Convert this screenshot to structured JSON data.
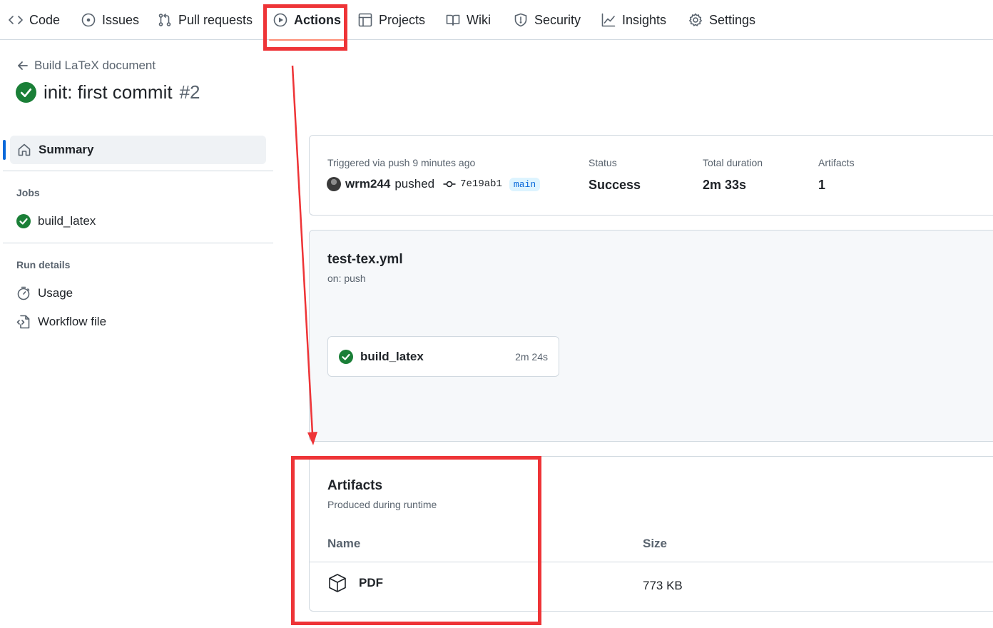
{
  "nav": {
    "tabs": [
      {
        "label": "Code",
        "icon": "code-icon"
      },
      {
        "label": "Issues",
        "icon": "issue-icon"
      },
      {
        "label": "Pull requests",
        "icon": "pull-request-icon"
      },
      {
        "label": "Actions",
        "icon": "play-icon",
        "active": true
      },
      {
        "label": "Projects",
        "icon": "table-icon"
      },
      {
        "label": "Wiki",
        "icon": "book-icon"
      },
      {
        "label": "Security",
        "icon": "shield-icon"
      },
      {
        "label": "Insights",
        "icon": "graph-icon"
      },
      {
        "label": "Settings",
        "icon": "gear-icon"
      }
    ]
  },
  "run": {
    "back_label": "Build LaTeX document",
    "title": "init: first commit",
    "number": "#2",
    "status_color": "#1a7f37"
  },
  "sidebar": {
    "summary_label": "Summary",
    "jobs_heading": "Jobs",
    "jobs": [
      {
        "label": "build_latex"
      }
    ],
    "run_details_heading": "Run details",
    "details": [
      {
        "label": "Usage",
        "icon": "stopwatch-icon"
      },
      {
        "label": "Workflow file",
        "icon": "file-code-icon"
      }
    ]
  },
  "summary_card": {
    "trigger_text": "Triggered via push 9 minutes ago",
    "user": "wrm244",
    "verb": "pushed",
    "sha": "7e19ab1",
    "branch": "main",
    "status_label": "Status",
    "status_value": "Success",
    "duration_label": "Total duration",
    "duration_value": "2m 33s",
    "artifacts_label": "Artifacts",
    "artifacts_value": "1"
  },
  "workflow": {
    "file": "test-tex.yml",
    "trigger": "on: push",
    "job_name": "build_latex",
    "job_duration": "2m 24s"
  },
  "artifacts": {
    "title": "Artifacts",
    "subtitle": "Produced during runtime",
    "col_name": "Name",
    "col_size": "Size",
    "rows": [
      {
        "name": "PDF",
        "size": "773 KB",
        "icon": "package-icon"
      }
    ]
  },
  "colors": {
    "accent": "#0969da",
    "success": "#1a7f37",
    "annotation_red": "#ee3437",
    "tab_underline": "#fd8c73"
  }
}
